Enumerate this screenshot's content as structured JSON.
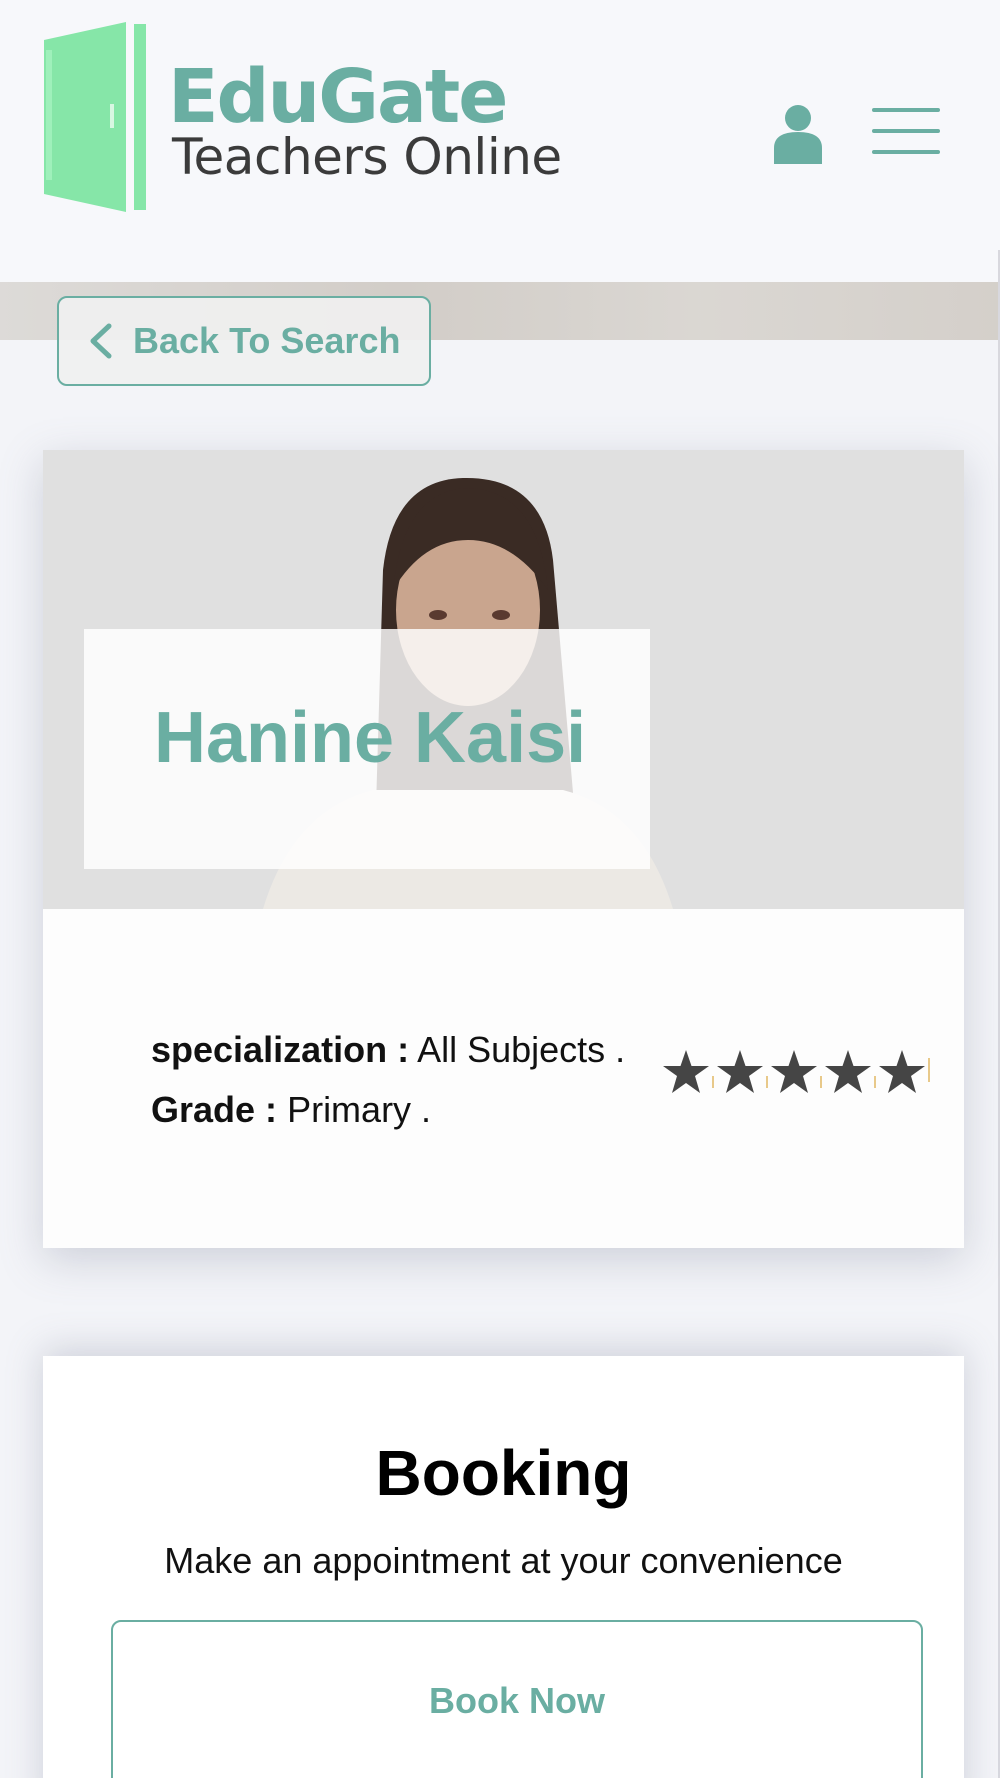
{
  "header": {
    "brand_name": "EduGate",
    "brand_tagline": "Teachers Online",
    "icons": {
      "account": "user-icon",
      "menu": "hamburger-menu-icon",
      "logo": "door-icon"
    }
  },
  "nav": {
    "back_label": "Back To Search"
  },
  "profile": {
    "name": "Hanine Kaisi",
    "specialization_label": "specialization :",
    "specialization_value": "All Subjects .",
    "grade_label": "Grade :",
    "grade_value": "Primary .",
    "rating_stars": 5
  },
  "booking": {
    "title": "Booking",
    "subtitle": "Make an appointment at your convenience",
    "button_label": "Book Now"
  },
  "colors": {
    "accent": "#6aaea2",
    "logo_green": "#86e6a8",
    "star": "#454545",
    "background": "#f3f4f8"
  }
}
